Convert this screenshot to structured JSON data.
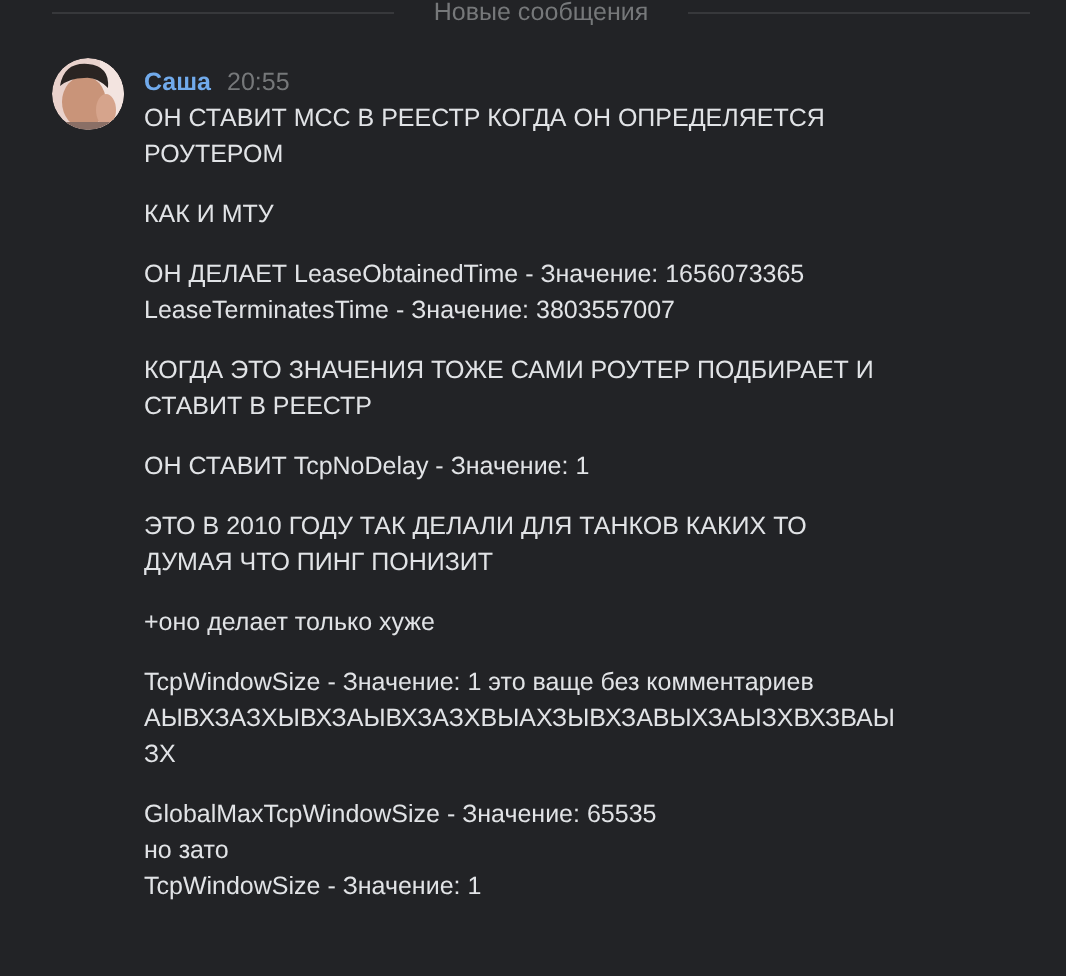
{
  "divider": {
    "label": "Новые сообщения"
  },
  "message": {
    "author": "Саша",
    "time": "20:55",
    "avatar": {
      "kind": "picture"
    },
    "paragraphs": [
      [
        "ОН СТАВИТ МСС В РЕЕСТР КОГДА ОН ОПРЕДЕЛЯЕТСЯ",
        "РОУТЕРОМ"
      ],
      [
        "КАК И МТУ"
      ],
      [
        "ОН ДЕЛАЕТ LeaseObtainedTime - Значение: 1656073365",
        "LeaseTerminatesTime - Значение: 3803557007"
      ],
      [
        "КОГДА ЭТО ЗНАЧЕНИЯ ТОЖЕ САМИ РОУТЕР ПОДБИРАЕТ И",
        "СТАВИТ В РЕЕСТР"
      ],
      [
        "ОН СТАВИТ TcpNoDelay - Значение: 1"
      ],
      [
        "ЭТО В 2010 ГОДУ ТАК ДЕЛАЛИ ДЛЯ ТАНКОВ КАКИХ ТО",
        "ДУМАЯ ЧТО ПИНГ ПОНИЗИТ"
      ],
      [
        "+оно делает только хуже"
      ],
      [
        "TcpWindowSize - Значение: 1 это ваще без комментариев",
        "АЫВХЗАЗХЫВХЗАЫВХЗАЗХВЫАХЗЫВХЗАВЫХЗАЫЗХВХЗВАЫ",
        "ЗХ"
      ],
      [
        "GlobalMaxTcpWindowSize - Значение: 65535",
        "но зато",
        "TcpWindowSize - Значение: 1"
      ]
    ]
  }
}
